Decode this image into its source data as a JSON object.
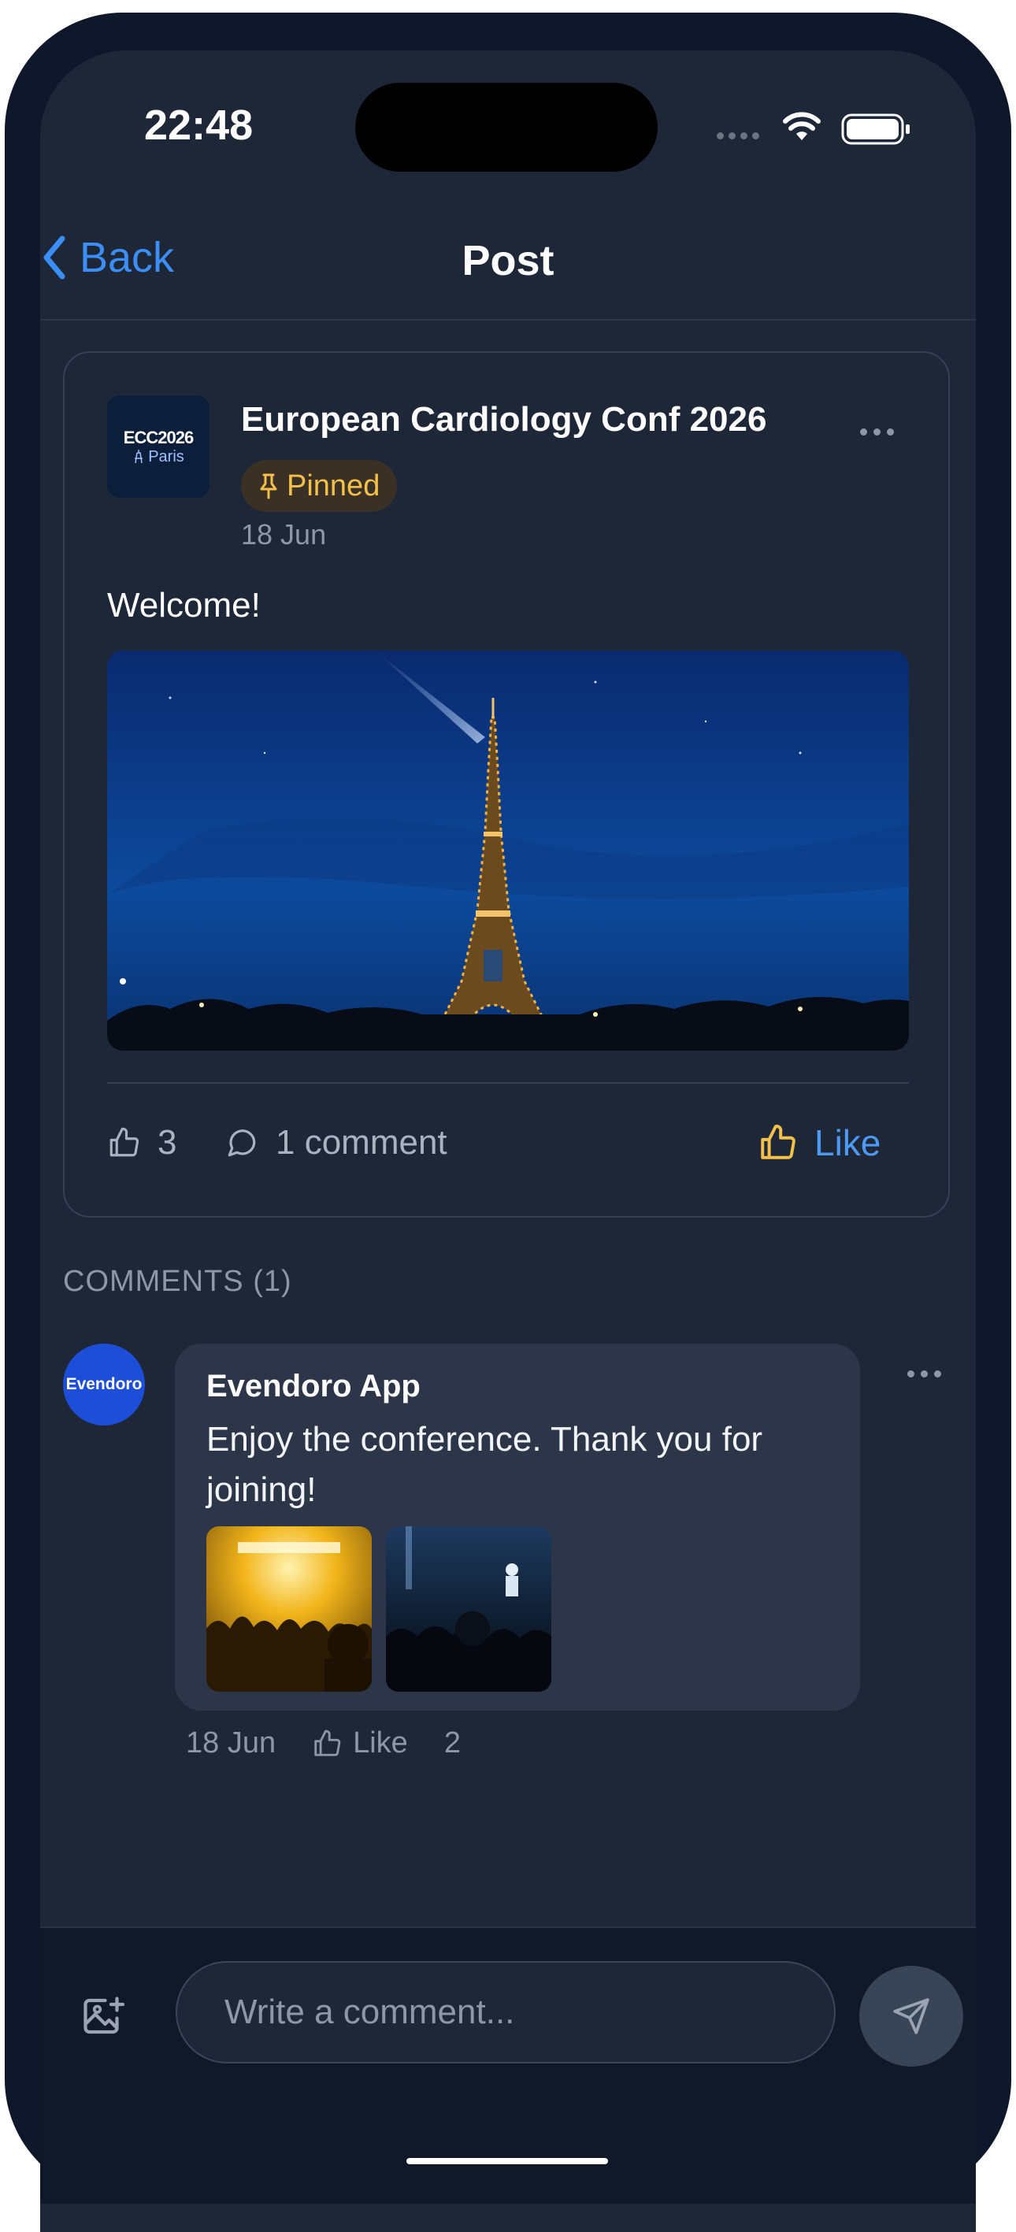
{
  "status_bar": {
    "time": "22:48"
  },
  "nav": {
    "back_label": "Back",
    "title": "Post"
  },
  "post": {
    "logo": {
      "line1": "ECC2026",
      "line2": "Paris"
    },
    "author": "European Cardiology Conf 2026",
    "badge": "Pinned",
    "date": "18 Jun",
    "text": "Welcome!",
    "likes_count": "3",
    "comments_label": "1 comment",
    "like_button": "Like"
  },
  "comments": {
    "header": "COMMENTS (1)",
    "items": [
      {
        "avatar_text": "Evendoro",
        "author": "Evendoro App",
        "text": "Enjoy the conference. Thank you for joining!",
        "date": "18 Jun",
        "like_label": "Like",
        "like_count": "2"
      }
    ]
  },
  "composer": {
    "placeholder": "Write a comment..."
  },
  "colors": {
    "accent": "#3b8ef5",
    "pinned": "#f3c14a",
    "background": "#1e2737"
  }
}
